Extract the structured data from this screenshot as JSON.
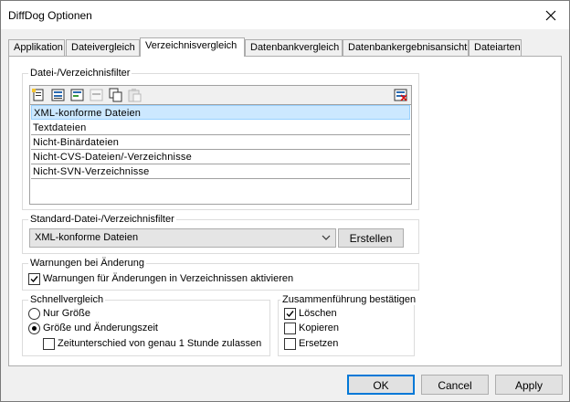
{
  "window": {
    "title": "DiffDog Optionen",
    "close_label": "✕"
  },
  "tabs": [
    {
      "label": "Applikation",
      "active": false
    },
    {
      "label": "Dateivergleich",
      "active": false
    },
    {
      "label": "Verzeichnisvergleich",
      "active": true
    },
    {
      "label": "Datenbankvergleich",
      "active": false
    },
    {
      "label": "Datenbankergebnisansicht",
      "active": false
    },
    {
      "label": "Dateiarten",
      "active": false
    }
  ],
  "filter_group": {
    "legend": "Datei-/Verzeichnisfilter",
    "toolbar_icons": [
      "new-filter-icon",
      "insert-filter-icon",
      "edit-filter-icon",
      "delete-filter-icon",
      "copy-filter-icon",
      "paste-filter-icon",
      "reset-filters-icon"
    ],
    "items": [
      {
        "label": "XML-konforme Dateien",
        "selected": true
      },
      {
        "label": "Textdateien",
        "selected": false
      },
      {
        "label": "Nicht-Binärdateien",
        "selected": false
      },
      {
        "label": "Nicht-CVS-Dateien/-Verzeichnisse",
        "selected": false
      },
      {
        "label": "Nicht-SVN-Verzeichnisse",
        "selected": false
      }
    ]
  },
  "standard_filter": {
    "legend": "Standard-Datei-/Verzeichnisfilter",
    "value": "XML-konforme Dateien",
    "create_label": "Erstellen"
  },
  "warnings": {
    "legend": "Warnungen bei Änderung",
    "checkbox_label": "Warnungen für Änderungen in Verzeichnissen aktivieren",
    "checked": true
  },
  "quick_compare": {
    "legend": "Schnellvergleich",
    "size_only": "Nur Größe",
    "size_and_time": "Größe und Änderungszeit",
    "selected": "size_and_time",
    "time_diff_label": "Zeitunterschied von genau 1 Stunde zulassen",
    "time_diff_checked": false
  },
  "confirm_merge": {
    "legend": "Zusammenführung bestätigen",
    "delete_label": "Löschen",
    "delete_checked": true,
    "copy_label": "Kopieren",
    "copy_checked": false,
    "replace_label": "Ersetzen",
    "replace_checked": false
  },
  "buttons": {
    "ok": "OK",
    "cancel": "Cancel",
    "apply": "Apply"
  }
}
